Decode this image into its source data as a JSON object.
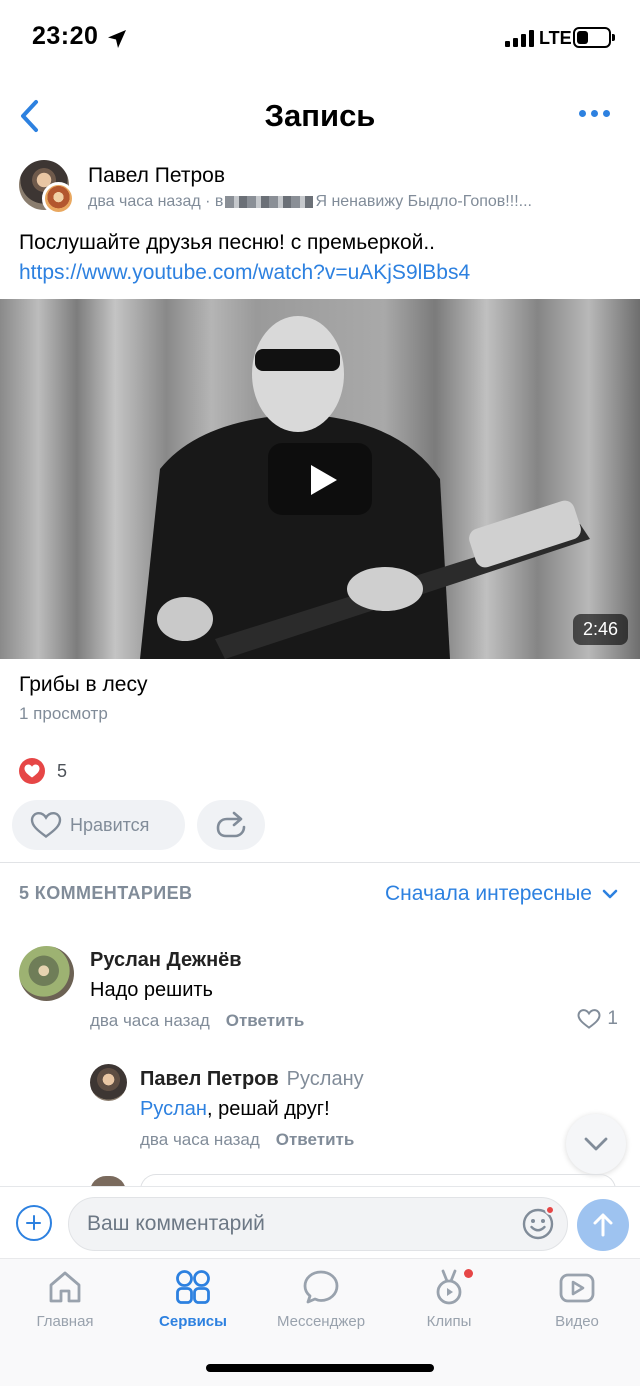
{
  "status_bar": {
    "time": "23:20",
    "network": "LTE",
    "battery_level": 0.35
  },
  "nav": {
    "title": "Запись"
  },
  "post": {
    "author": "Павел Петров",
    "time": "два часа назад",
    "group_prefix": "· в",
    "group_name": "Я ненавижу Быдло-Гопов!!!...",
    "text": "Послушайте друзья песню! с премьеркой..",
    "link": "https://www.youtube.com/watch?v=uAKjS9lBbs4",
    "video": {
      "duration": "2:46",
      "title": "Грибы в лесу",
      "views": "1 просмотр"
    },
    "likes_count": "5",
    "like_label": "Нравится"
  },
  "comments_section": {
    "header": "5 КОММЕНТАРИЕВ",
    "sort_label": "Сначала интересные",
    "comments": [
      {
        "author": "Руслан Дежнёв",
        "text": "Надо решить",
        "time": "два часа назад",
        "reply_label": "Ответить",
        "likes": "1"
      },
      {
        "author": "Павел Петров",
        "reply_to": "Руслану",
        "mention": "Руслан",
        "text": ", решай друг!",
        "time": "два часа назад",
        "reply_label": "Ответить"
      }
    ]
  },
  "composer": {
    "placeholder": "Ваш комментарий"
  },
  "tabs": [
    {
      "label": "Главная",
      "icon": "home-icon"
    },
    {
      "label": "Сервисы",
      "icon": "services-icon",
      "active": true
    },
    {
      "label": "Мессенджер",
      "icon": "messenger-icon"
    },
    {
      "label": "Клипы",
      "icon": "clips-icon"
    },
    {
      "label": "Видео",
      "icon": "video-icon"
    }
  ],
  "colors": {
    "accent": "#2d81e0",
    "like_red": "#e64646",
    "secondary_text": "#818c99"
  }
}
